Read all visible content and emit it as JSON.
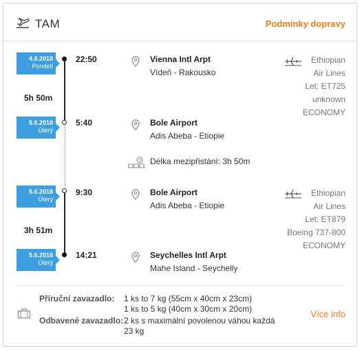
{
  "header": {
    "title": "TAM",
    "terms_link": "Podmínky dopravy",
    "icon": "plane-departure-icon"
  },
  "segments": [
    {
      "departure": {
        "date": "4.6.2018",
        "weekday": "Pondelí",
        "time": "22:50",
        "airport": "Vienna Intl Arpt",
        "city": "Vídeň - Rakousko"
      },
      "duration": "5h 50m",
      "arrival": {
        "date": "5.6.2018",
        "weekday": "Úterý",
        "time": "5:40",
        "airport": "Bole Airport",
        "city": "Adis Abeba - Etiopie"
      },
      "airline_lines": [
        "Ethiopian",
        "Air Lines",
        "Let: ET725",
        "unknown",
        "ECONOMY"
      ]
    },
    {
      "departure": {
        "date": "5.6.2018",
        "weekday": "Úterý",
        "time": "9:30",
        "airport": "Bole Airport",
        "city": "Adis Abeba - Etiopie"
      },
      "duration": "3h 51m",
      "arrival": {
        "date": "5.6.2018",
        "weekday": "Úterý",
        "time": "14:21",
        "airport": "Seychelles Intl Arpt",
        "city": "Mahe Island - Seychelly"
      },
      "airline_lines": [
        "Ethiopian",
        "Air Lines",
        "Let: ET879",
        "Boeing 737-800",
        "ECONOMY"
      ]
    }
  ],
  "layover": {
    "text": "Délka mezipřistání: 3h 50m"
  },
  "baggage": {
    "carry_on_label": "Příruční zavazadlo:",
    "carry_on_lines": [
      "1 ks to 7 kg (55cm x 40cm x 23cm)",
      "1 ks to 5 kg (40cm x 30cm x 20cm)"
    ],
    "checked_label": "Odbavené zavazadlo:",
    "checked_lines": [
      "2 ks s maximální povolenou váhou každá",
      "23 kg"
    ],
    "more_link": "Více info"
  },
  "colors": {
    "accent": "#f37b1d",
    "date_badge": "#3d9fe0"
  }
}
